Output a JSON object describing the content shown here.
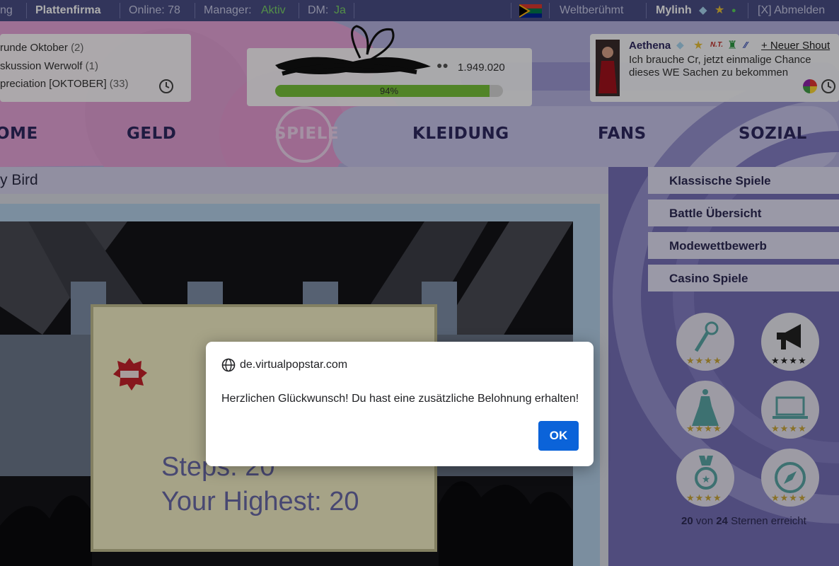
{
  "topbar": {
    "items": [
      "ng",
      "Plattenfirma",
      "Online: 78",
      "Manager:",
      "Aktiv",
      "DM:",
      "Ja",
      "Weltberühmt",
      "Mylinh",
      "[X] Abmelden"
    ]
  },
  "shouts": {
    "items": [
      {
        "title": "runde Oktober",
        "count": "(2)"
      },
      {
        "title": "skussion Werwolf",
        "count": "(1)"
      },
      {
        "title": "preciation [OKTOBER]",
        "count": "(33)"
      }
    ]
  },
  "player": {
    "money": "1.949.020",
    "progress_label": "94%",
    "progress_value": 0.94
  },
  "latest_shout": {
    "user": "Aethena",
    "new_shout_label": "+ Neuer Shout",
    "message_line1": "Ich brauche Cr, jetzt einmalige Chance",
    "message_line2": "dieses WE Sachen zu bekommen"
  },
  "nav": {
    "items": [
      "OME",
      "GELD",
      "SPIELE",
      "KLEIDUNG",
      "FANS",
      "SOZIAL"
    ]
  },
  "game": {
    "title": "y Bird",
    "steps_label": "Steps: 20",
    "highest_label": "Your Highest: 20"
  },
  "right_menu": {
    "items": [
      "Klassische Spiele",
      "Battle Übersicht",
      "Modewettbewerb",
      "Casino Spiele"
    ]
  },
  "stars_summary": {
    "earned": "20",
    "middle": "von",
    "total": "24",
    "suffix": "Sternen erreicht"
  },
  "dialog": {
    "origin": "de.virtualpopstar.com",
    "message": "Herzlichen Glückwunsch! Du hast eine zusätzliche Belohnung erhalten!",
    "ok_label": "OK"
  },
  "colors": {
    "accent_blue": "#0b63d9",
    "progress_green": "#78c33a",
    "topbar_bg": "#4a4f86",
    "active_green": "#7bd36a"
  },
  "icons": [
    "flag-icon",
    "diamond-icon",
    "star-icon",
    "online-dot-icon",
    "clock-icon",
    "trophy-icon",
    "globe-icon",
    "microphone-icon",
    "megaphone-icon",
    "dress-icon",
    "laptop-icon",
    "medal-icon",
    "compass-icon"
  ]
}
